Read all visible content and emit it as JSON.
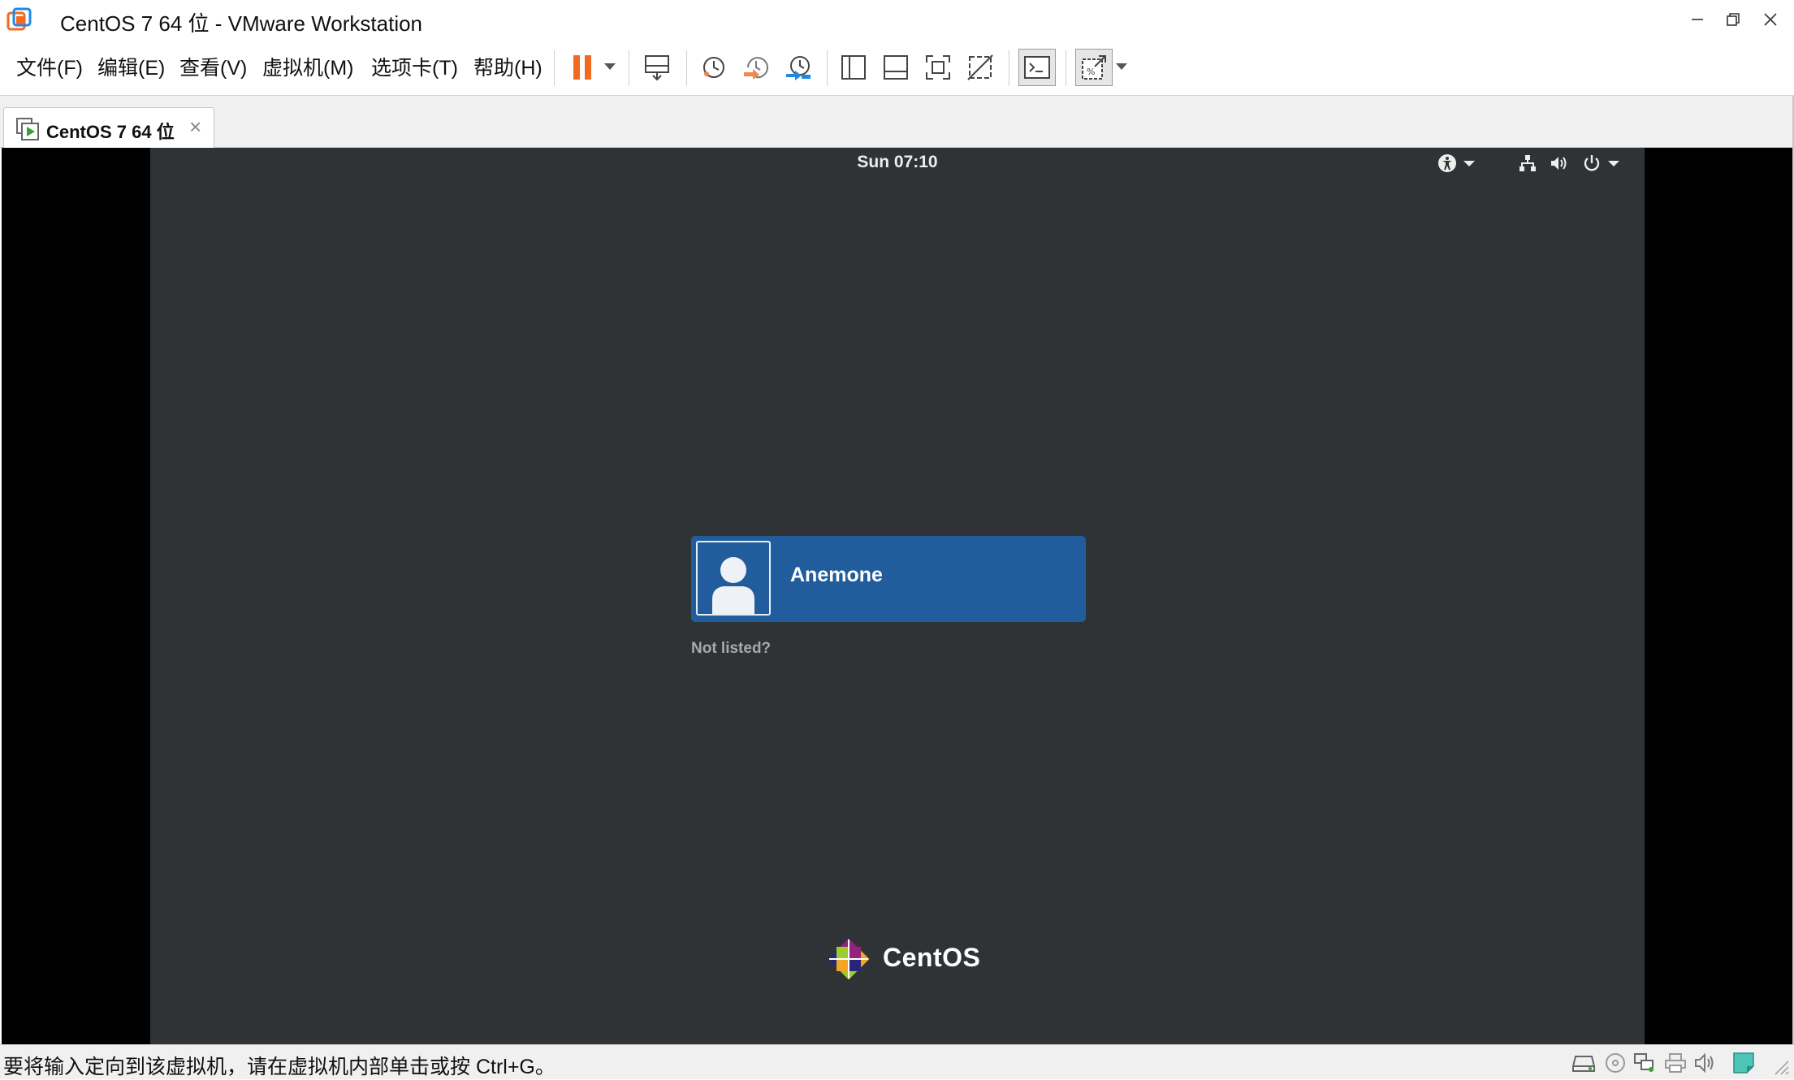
{
  "window": {
    "title": "CentOS 7 64 位 - VMware Workstation",
    "controls": [
      "minimize-icon",
      "restore-icon",
      "close-icon"
    ]
  },
  "menu": {
    "items": [
      "文件(F)",
      "编辑(E)",
      "查看(V)",
      "虚拟机(M)",
      "选项卡(T)",
      "帮助(H)"
    ]
  },
  "toolbar": {
    "buttons": [
      "pause-icon",
      "send-keys-icon",
      "snapshot-icon",
      "revert-snapshot-icon",
      "snapshot-manager-icon",
      "library-icon",
      "thumbnail-bar-icon",
      "full-screen-icon",
      "unity-icon",
      "console-view-icon",
      "stretch-guest-icon"
    ],
    "colors": {
      "pause": "#f26a21",
      "snapshot_revert": "#f08a4b",
      "snapshot_manager": "#1e88e5"
    }
  },
  "tab": {
    "label": "CentOS 7 64 位",
    "close": "×"
  },
  "guest": {
    "clock": "Sun 07:10",
    "user": {
      "name": "Anemone"
    },
    "not_listed": "Not listed?",
    "brand": "CentOS",
    "colors": {
      "background": "#303336",
      "user_card": "#215d9c"
    }
  },
  "statusbar": {
    "text": "要将输入定向到该虚拟机，请在虚拟机内部单击或按 Ctrl+G。",
    "icons": [
      "hard-disk-icon",
      "cd-dvd-icon",
      "network-adapter-icon",
      "printer-icon",
      "sound-card-icon",
      "message-log-icon"
    ]
  }
}
